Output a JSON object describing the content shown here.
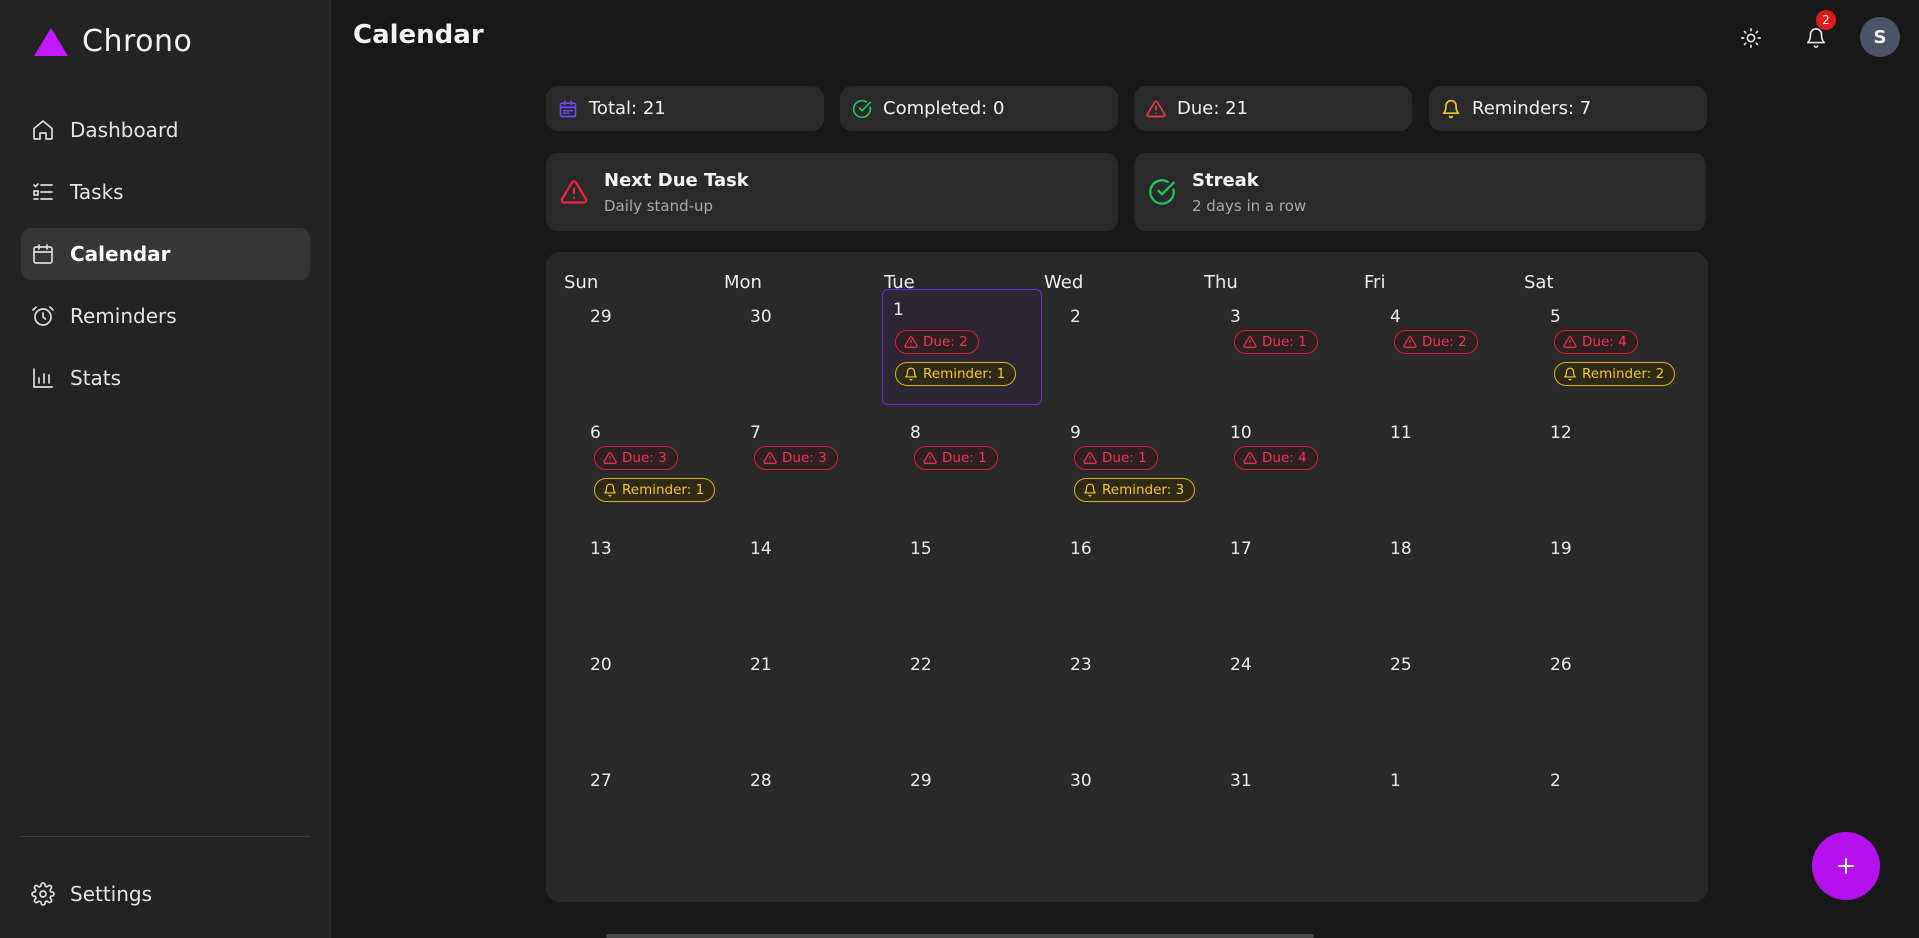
{
  "app": {
    "name": "Chrono"
  },
  "sidebar": {
    "items": [
      {
        "label": "Dashboard",
        "icon": "home-icon"
      },
      {
        "label": "Tasks",
        "icon": "list-icon"
      },
      {
        "label": "Calendar",
        "icon": "calendar-icon",
        "active": true
      },
      {
        "label": "Reminders",
        "icon": "alarm-clock-icon"
      },
      {
        "label": "Stats",
        "icon": "bar-chart-icon"
      }
    ],
    "settings_label": "Settings"
  },
  "header": {
    "title": "Calendar",
    "notification_count": "2",
    "avatar_initial": "S"
  },
  "stats": {
    "total": "Total: 21",
    "completed": "Completed: 0",
    "due": "Due: 21",
    "reminders": "Reminders: 7"
  },
  "next_due": {
    "title": "Next Due Task",
    "subtitle": "Daily stand-up"
  },
  "streak": {
    "title": "Streak",
    "subtitle": "2 days in a row"
  },
  "colors": {
    "accent": "#c21bff",
    "due": "#f0384f",
    "reminder": "#f2c92a",
    "success": "#22c55e",
    "total": "#6d4bff"
  },
  "calendar": {
    "weekdays": [
      "Sun",
      "Mon",
      "Tue",
      "Wed",
      "Thu",
      "Fri",
      "Sat"
    ],
    "weeks": [
      [
        {
          "day": "29"
        },
        {
          "day": "30"
        },
        {
          "day": "1",
          "today": true,
          "due": "Due: 2",
          "reminder": "Reminder: 1"
        },
        {
          "day": "2"
        },
        {
          "day": "3",
          "due": "Due: 1"
        },
        {
          "day": "4",
          "due": "Due: 2"
        },
        {
          "day": "5",
          "due": "Due: 4",
          "reminder": "Reminder: 2"
        }
      ],
      [
        {
          "day": "6",
          "due": "Due: 3",
          "reminder": "Reminder: 1"
        },
        {
          "day": "7",
          "due": "Due: 3"
        },
        {
          "day": "8",
          "due": "Due: 1"
        },
        {
          "day": "9",
          "due": "Due: 1",
          "reminder": "Reminder: 3"
        },
        {
          "day": "10",
          "due": "Due: 4"
        },
        {
          "day": "11"
        },
        {
          "day": "12"
        }
      ],
      [
        {
          "day": "13"
        },
        {
          "day": "14"
        },
        {
          "day": "15"
        },
        {
          "day": "16"
        },
        {
          "day": "17"
        },
        {
          "day": "18"
        },
        {
          "day": "19"
        }
      ],
      [
        {
          "day": "20"
        },
        {
          "day": "21"
        },
        {
          "day": "22"
        },
        {
          "day": "23"
        },
        {
          "day": "24"
        },
        {
          "day": "25"
        },
        {
          "day": "26"
        }
      ],
      [
        {
          "day": "27"
        },
        {
          "day": "28"
        },
        {
          "day": "29"
        },
        {
          "day": "30"
        },
        {
          "day": "31"
        },
        {
          "day": "1"
        },
        {
          "day": "2"
        }
      ]
    ]
  }
}
